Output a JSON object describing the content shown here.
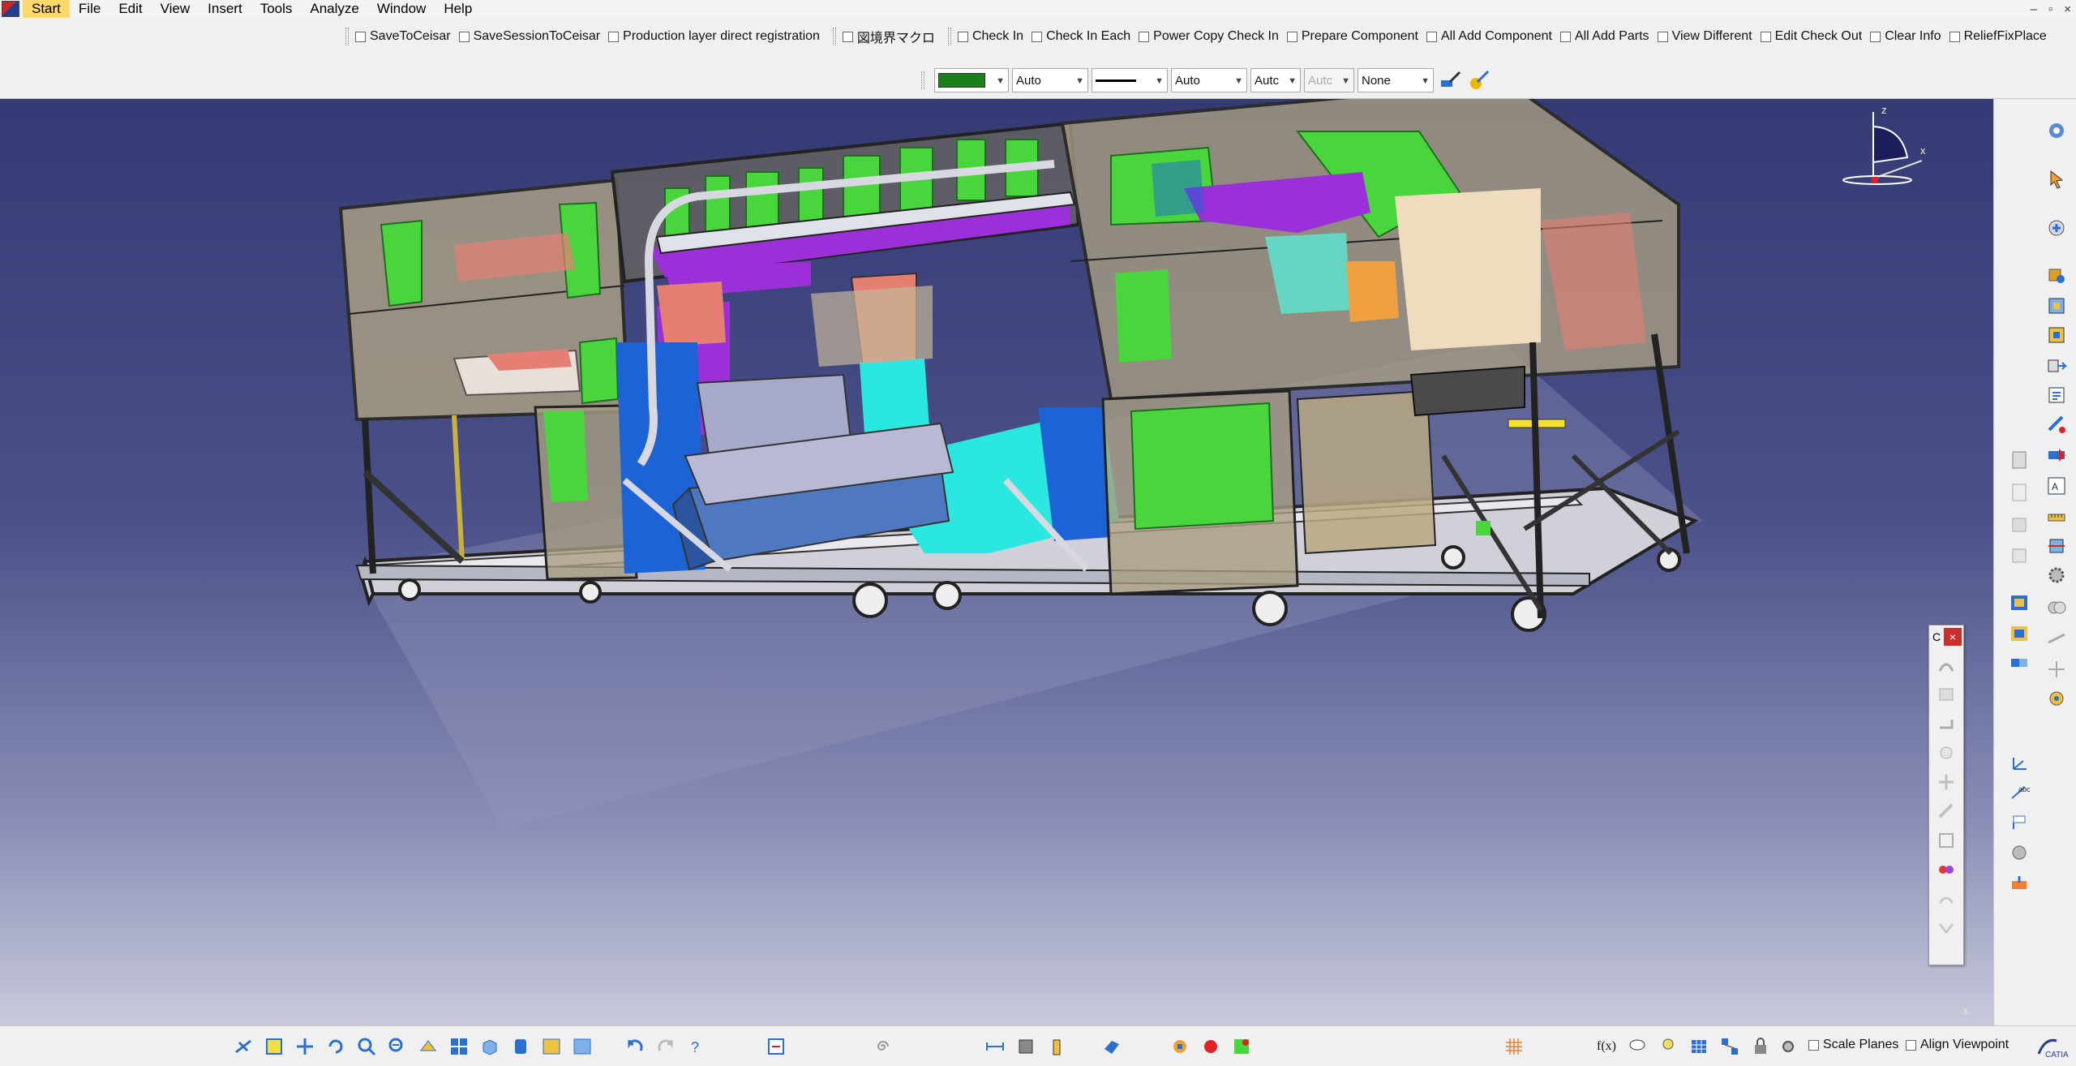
{
  "menubar": {
    "items": [
      {
        "label": "Start"
      },
      {
        "label": "File"
      },
      {
        "label": "Edit"
      },
      {
        "label": "View"
      },
      {
        "label": "Insert"
      },
      {
        "label": "Tools"
      },
      {
        "label": "Analyze"
      },
      {
        "label": "Window"
      },
      {
        "label": "Help"
      }
    ],
    "window_controls": [
      "–",
      "▫",
      "×"
    ]
  },
  "command_toolbar": {
    "group1": [
      "SaveToCeisar",
      "SaveSessionToCeisar",
      "Production layer direct registration"
    ],
    "group2": [
      "図境界マクロ"
    ],
    "group3": [
      "Check In",
      "Check In Each",
      "Power Copy Check In",
      "Prepare Component",
      "All Add Component",
      "All Add Parts",
      "View Different",
      "Edit Check Out",
      "Clear Info",
      "ReliefFixPlace"
    ]
  },
  "properties_toolbar": {
    "color_value": "#1b7f1b",
    "transparency": "Auto",
    "line_type": "solid",
    "thickness": "Auto",
    "point_symbol": "Autc",
    "disabled_value": "Autc",
    "layer": "None"
  },
  "compass": {
    "axis_z": "z",
    "axis_x": "x"
  },
  "float_panel": {
    "title": "C",
    "close": "×"
  },
  "bottom_toolbar": {
    "scale_planes": "Scale Planes",
    "align_viewpoint": "Align Viewpoint",
    "formula_label": "f(x)"
  },
  "colors": {
    "accent_green": "#3ccf3c",
    "magenta": "#9b30d9",
    "cyan": "#2ae8e0",
    "blue": "#1c63d6",
    "salmon": "#e57b73",
    "frame_tan": "#b8a27a"
  }
}
